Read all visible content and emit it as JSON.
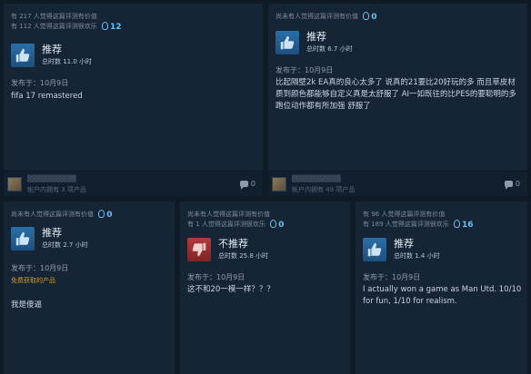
{
  "reviews": [
    {
      "helpful_line1": "有 217 人觉得这篇评测有价值",
      "helpful_line2": "有 112 人觉得这篇评测很欢乐",
      "awards": "12",
      "verdict": "推荐",
      "hours": "总时数 11.0 小时",
      "posted": "发布于：10月9日",
      "body": "fifa 17 remastered",
      "owns": "帐户内拥有 3 项产品",
      "comments": "0"
    },
    {
      "helpful_line1": "尚未有人觉得这篇评测有价值",
      "awards": "0",
      "verdict": "推荐",
      "hours": "总时数 6.7 小时",
      "posted": "发布于：10月9日",
      "body": "比起隔壁2k EA真的良心太多了 说真的21要比20好玩的多 而且草皮材质到颜色都能够自定义真是太舒服了 AI一如既往的比PES的要聪明的多 跑位动作都有所加强 舒服了",
      "owns": "帐户内拥有 49 项产品",
      "comments": "0"
    },
    {
      "helpful_line1": "尚未有人觉得这篇评测有价值",
      "awards": "0",
      "verdict": "推荐",
      "hours": "总时数 2.7 小时",
      "posted": "发布于：10月9日",
      "free_note": "免费获取的产品",
      "body": "我是傻逼"
    },
    {
      "helpful_line1": "尚未有人觉得这篇评测有价值",
      "helpful_line2": "有 1 人觉得这篇评测很欢乐",
      "awards": "0",
      "verdict": "不推荐",
      "hours": "总时数 25.8 小时",
      "posted": "发布于：10月9日",
      "body": "这不和20一模一样？？？"
    },
    {
      "helpful_line1": "有 96 人觉得这篇评测有价值",
      "helpful_line2": "有 189 人觉得这篇评测很欢乐",
      "awards": "16",
      "verdict": "推荐",
      "hours": "总时数 1.4 小时",
      "posted": "发布于：10月9日",
      "body": "I actually won a game as Man Utd. 10/10 for fun, 1/10 for realism."
    }
  ],
  "icons": {
    "thumbs_up": "thumbs-up-icon",
    "thumbs_down": "thumbs-down-icon",
    "award": "award-icon",
    "comment": "comment-bubble-icon"
  },
  "colors": {
    "page_bg": "#0f1a27",
    "card_bg": "#162536",
    "recommended": "#2a6fa8",
    "not_recommended": "#b23b3b",
    "award": "#66c0f4",
    "free_note": "#c99a2e"
  }
}
